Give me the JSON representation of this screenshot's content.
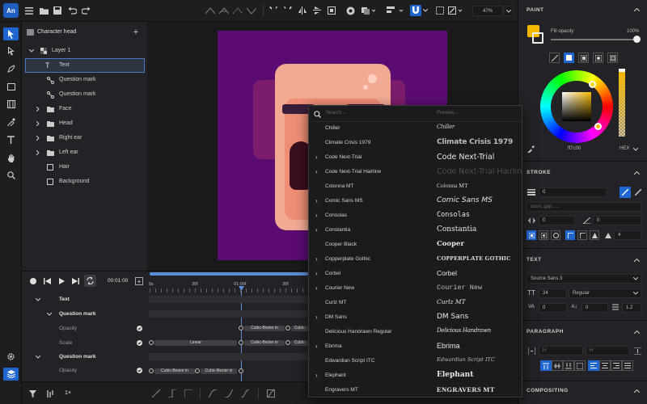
{
  "app": {
    "logo": "An"
  },
  "toolbar": {
    "zoom": "47%"
  },
  "layers": {
    "title": "Character head",
    "rows": [
      {
        "label": "Layer 1"
      },
      {
        "label": "Text"
      },
      {
        "label": "Question mark"
      },
      {
        "label": "Question mark"
      },
      {
        "label": "Face"
      },
      {
        "label": "Head"
      },
      {
        "label": "Right ear"
      },
      {
        "label": "Left ear"
      },
      {
        "label": "Hair"
      },
      {
        "label": "Background"
      }
    ]
  },
  "playback": {
    "time": "00:01:00"
  },
  "timeline": {
    "ruler": [
      "0s",
      "30f",
      "01:00f",
      "30f"
    ],
    "rows": [
      {
        "label": "Text"
      },
      {
        "label": "Question mark"
      },
      {
        "label": "Opacity"
      },
      {
        "label": "Scale"
      },
      {
        "label": "Question mark"
      },
      {
        "label": "Opacity"
      }
    ],
    "segments": {
      "linear": "Linear",
      "cubic": "Cubic-Bezier in",
      "cubic_short": "Cubic-"
    }
  },
  "bottom": {
    "speed": "1×"
  },
  "font_dropdown": {
    "search_placeholder": "Search...",
    "preview_header": "Preview...",
    "fonts": [
      {
        "name": "Chiller",
        "preview": "Chiller",
        "expandable": false
      },
      {
        "name": "Climate Crisis 1979",
        "preview": "Climate Crisis 1979",
        "expandable": false
      },
      {
        "name": "Code Next-Trial",
        "preview": "Code Next-Trial",
        "expandable": true
      },
      {
        "name": "Code Next-Trial Hairline",
        "preview": "Code Next-Trial Hairline",
        "expandable": true
      },
      {
        "name": "Colonna MT",
        "preview": "Colonna MT",
        "expandable": false
      },
      {
        "name": "Comic Sans MS",
        "preview": "Comic Sans MS",
        "expandable": true
      },
      {
        "name": "Consolas",
        "preview": "Consolas",
        "expandable": true
      },
      {
        "name": "Constantia",
        "preview": "Constantia",
        "expandable": true
      },
      {
        "name": "Cooper Black",
        "preview": "Cooper",
        "expandable": false
      },
      {
        "name": "Copperplate Gothic",
        "preview": "COPPERPLATE GOTHIC",
        "expandable": true
      },
      {
        "name": "Corbel",
        "preview": "Corbel",
        "expandable": true
      },
      {
        "name": "Courier New",
        "preview": "Courier New",
        "expandable": true
      },
      {
        "name": "Curlz MT",
        "preview": "Curlz MT",
        "expandable": false
      },
      {
        "name": "DM Sans",
        "preview": "DM Sans",
        "expandable": true
      },
      {
        "name": "Delicious Handrawn Regular",
        "preview": "Delicious Handrawn",
        "expandable": false
      },
      {
        "name": "Ebrima",
        "preview": "Ebrima",
        "expandable": true
      },
      {
        "name": "Edwardian Script ITC",
        "preview": "Edwardian Script ITC",
        "expandable": false
      },
      {
        "name": "Elephant",
        "preview": "Elephant",
        "expandable": true
      },
      {
        "name": "Engravers MT",
        "preview": "ENGRAVERS MT",
        "expandable": false
      }
    ]
  },
  "paint": {
    "section": "PAINT",
    "fill_opacity_label": "Fill opacity",
    "fill_opacity_value": "100%",
    "fill_opacity_fraction": 1.0,
    "fill_color": "#f5b800",
    "hex_value": "ff7c00",
    "hex_mode": "HEX"
  },
  "stroke": {
    "section": "STROKE",
    "width": "0",
    "dash_placeholder": "dash, gap, ...",
    "offset": "0",
    "angle": "0",
    "miter": "4"
  },
  "text": {
    "section": "TEXT",
    "font_family": "Source Sans 3",
    "size": "24",
    "weight": "Regular",
    "tracking": "0",
    "baseline": "0",
    "line_height": "1.2"
  },
  "paragraph": {
    "section": "PARAGRAPH",
    "indent_placeholder": "H",
    "spacing_placeholder": "H"
  },
  "compositing": {
    "section": "COMPOSITING"
  }
}
